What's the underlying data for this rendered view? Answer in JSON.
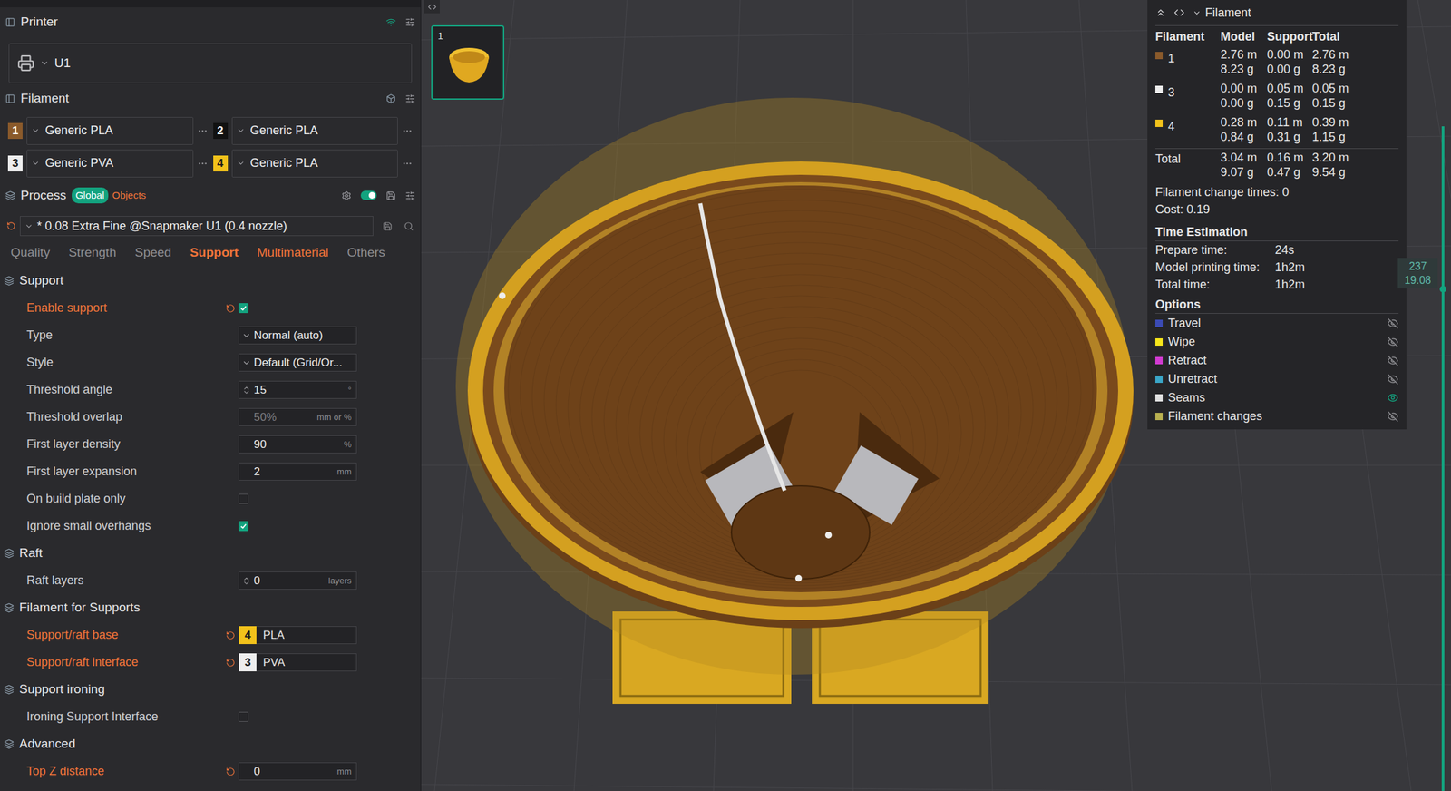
{
  "printer": {
    "title": "Printer",
    "name": "U1"
  },
  "filament": {
    "title": "Filament",
    "slots": [
      {
        "index": "1",
        "name": "Generic PLA",
        "color": "#8a5a2b"
      },
      {
        "index": "2",
        "name": "Generic PLA",
        "color": "#111111"
      },
      {
        "index": "3",
        "name": "Generic PVA",
        "color": "#eeeeee"
      },
      {
        "index": "4",
        "name": "Generic PLA",
        "color": "#f2c21b"
      }
    ]
  },
  "process": {
    "title": "Process",
    "scopes": [
      {
        "label": "Global",
        "selected": true
      },
      {
        "label": "Objects",
        "selected": false
      }
    ],
    "preset": "* 0.08 Extra Fine @Snapmaker U1 (0.4 nozzle)",
    "tabs": [
      {
        "label": "Quality",
        "selected": false,
        "modified": false
      },
      {
        "label": "Strength",
        "selected": false,
        "modified": false
      },
      {
        "label": "Speed",
        "selected": false,
        "modified": false
      },
      {
        "label": "Support",
        "selected": true,
        "modified": true
      },
      {
        "label": "Multimaterial",
        "selected": false,
        "modified": true
      },
      {
        "label": "Others",
        "selected": false,
        "modified": false
      }
    ]
  },
  "sections": [
    {
      "title": "Support",
      "rows": [
        {
          "label": "Enable support",
          "kind": "checkbox",
          "checked": true,
          "modified": true
        },
        {
          "label": "Type",
          "kind": "select",
          "value": "Normal (auto)",
          "modified": false
        },
        {
          "label": "Style",
          "kind": "select",
          "value": "Default (Grid/Or...",
          "modified": false
        },
        {
          "label": "Threshold angle",
          "kind": "spin",
          "value": "15",
          "unit": "°",
          "modified": false
        },
        {
          "label": "Threshold overlap",
          "kind": "input",
          "value": "50%",
          "unit": "mm or %",
          "disabled": true,
          "modified": false
        },
        {
          "label": "First layer density",
          "kind": "input",
          "value": "90",
          "unit": "%",
          "disabled": false,
          "modified": false
        },
        {
          "label": "First layer expansion",
          "kind": "input",
          "value": "2",
          "unit": "mm",
          "disabled": false,
          "modified": false
        },
        {
          "label": "On build plate only",
          "kind": "checkbox",
          "checked": false,
          "modified": false
        },
        {
          "label": "Ignore small overhangs",
          "kind": "checkbox",
          "checked": true,
          "modified": false
        }
      ]
    },
    {
      "title": "Raft",
      "rows": [
        {
          "label": "Raft layers",
          "kind": "spin",
          "value": "0",
          "unit": "layers",
          "modified": false
        }
      ]
    },
    {
      "title": "Filament for Supports",
      "rows": [
        {
          "label": "Support/raft base",
          "kind": "filament",
          "slot": "4",
          "value": "PLA",
          "color": "#f2c21b",
          "modified": true
        },
        {
          "label": "Support/raft interface",
          "kind": "filament",
          "slot": "3",
          "value": "PVA",
          "color": "#eeeeee",
          "modified": true
        }
      ]
    },
    {
      "title": "Support ironing",
      "rows": [
        {
          "label": "Ironing Support Interface",
          "kind": "checkbox",
          "checked": false,
          "modified": false
        }
      ]
    },
    {
      "title": "Advanced",
      "rows": [
        {
          "label": "Top Z distance",
          "kind": "input",
          "value": "0",
          "unit": "mm",
          "disabled": false,
          "modified": true
        }
      ]
    }
  ],
  "plate": {
    "label": "1"
  },
  "stats": {
    "title": "Filament",
    "columns": [
      "Filament",
      "Model",
      "Support",
      "Total"
    ],
    "rows": [
      {
        "id": "1",
        "color": "#8a5a2b",
        "model": [
          "2.76 m",
          "8.23 g"
        ],
        "support": [
          "0.00 m",
          "0.00 g"
        ],
        "total": [
          "2.76 m",
          "8.23 g"
        ]
      },
      {
        "id": "3",
        "color": "#eeeeee",
        "model": [
          "0.00 m",
          "0.00 g"
        ],
        "support": [
          "0.05 m",
          "0.15 g"
        ],
        "total": [
          "0.05 m",
          "0.15 g"
        ]
      },
      {
        "id": "4",
        "color": "#f2c21b",
        "model": [
          "0.28 m",
          "0.84 g"
        ],
        "support": [
          "0.11 m",
          "0.31 g"
        ],
        "total": [
          "0.39 m",
          "1.15 g"
        ]
      }
    ],
    "total": {
      "label": "Total",
      "model": [
        "3.04 m",
        "9.07 g"
      ],
      "support": [
        "0.16 m",
        "0.47 g"
      ],
      "total": [
        "3.20 m",
        "9.54 g"
      ]
    },
    "changes": "Filament change times: 0",
    "cost": "Cost: 0.19",
    "time_title": "Time Estimation",
    "times": [
      {
        "label": "Prepare time:",
        "value": "24s"
      },
      {
        "label": "Model printing time:",
        "value": "1h2m"
      },
      {
        "label": "Total time:",
        "value": "1h2m"
      }
    ],
    "options_title": "Options",
    "options": [
      {
        "label": "Travel",
        "color": "#3b4bb5",
        "visible": false
      },
      {
        "label": "Wipe",
        "color": "#f5e51b",
        "visible": false
      },
      {
        "label": "Retract",
        "color": "#d23bd2",
        "visible": false
      },
      {
        "label": "Unretract",
        "color": "#3aa6c8",
        "visible": false
      },
      {
        "label": "Seams",
        "color": "#e0e0e0",
        "visible": true
      },
      {
        "label": "Filament changes",
        "color": "#b8b050",
        "visible": false
      }
    ]
  },
  "layer_slider": {
    "layer": "237",
    "height": "19.08",
    "level": 1
  }
}
